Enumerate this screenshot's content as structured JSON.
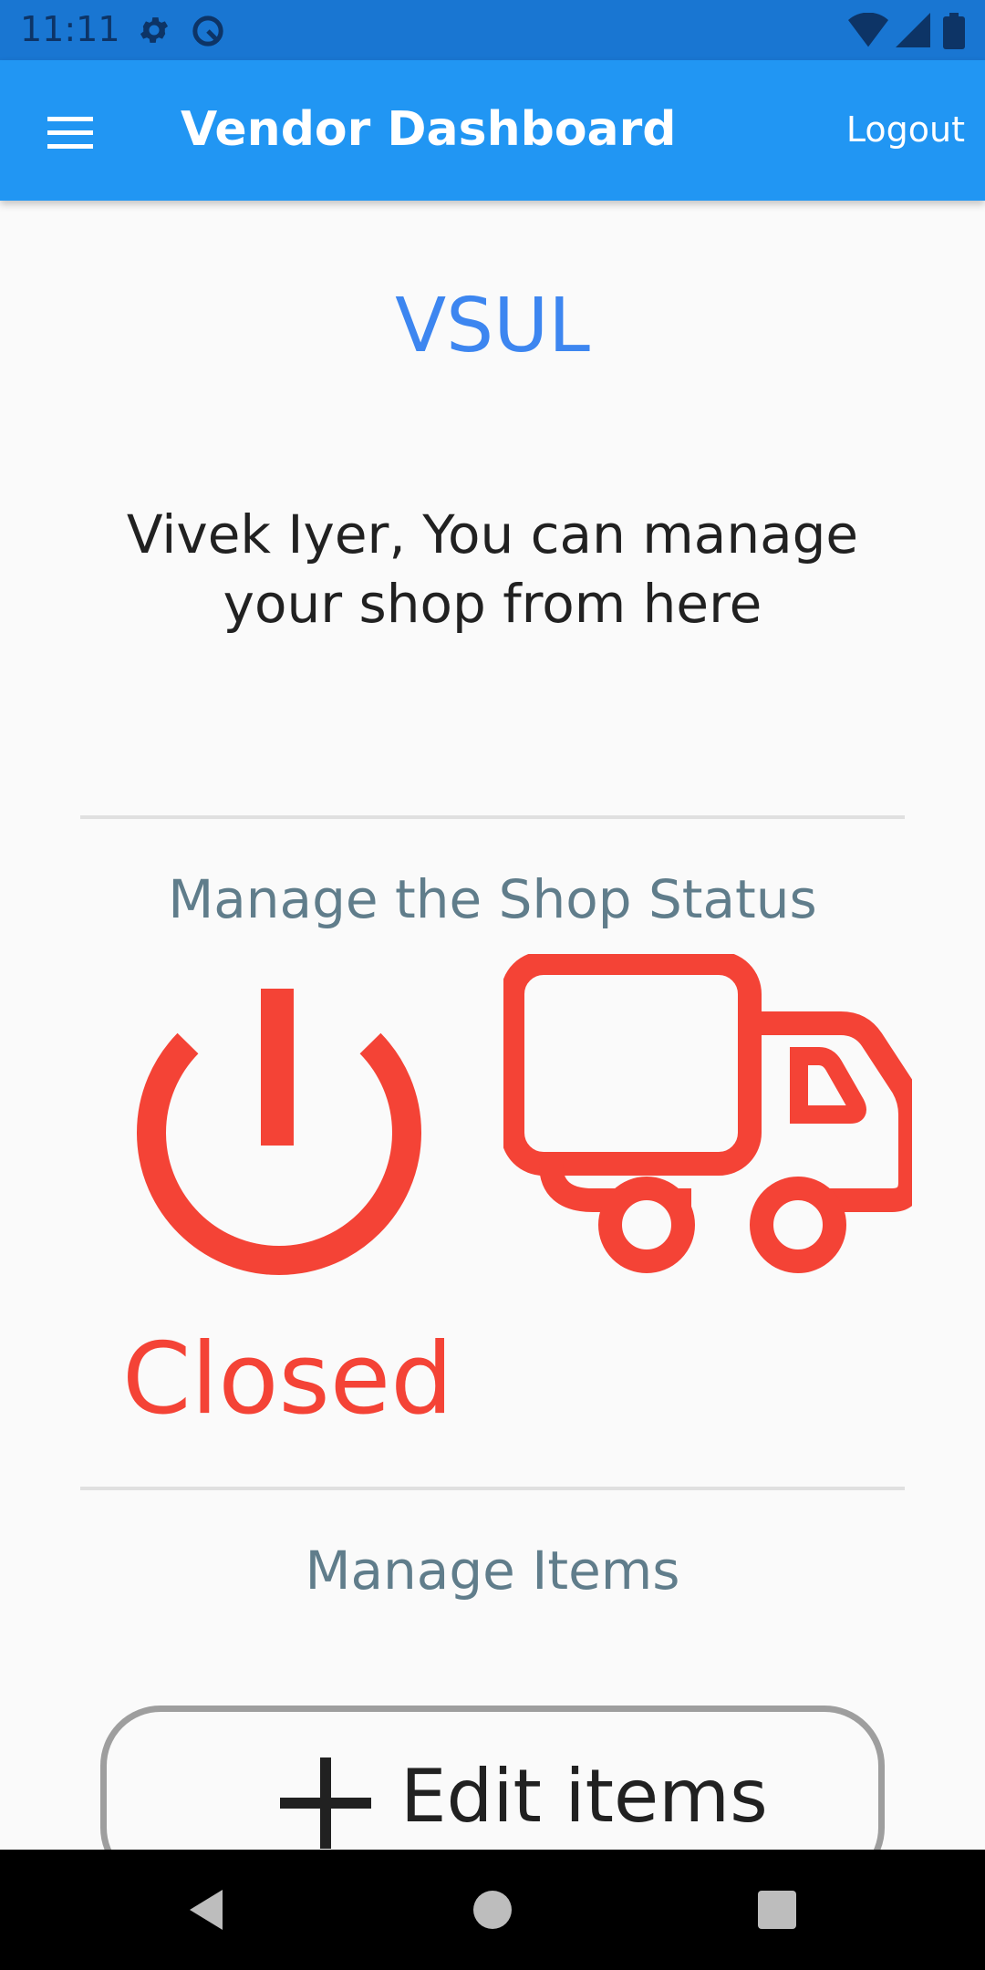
{
  "status_bar": {
    "time": "11:11",
    "icons": [
      "gear-icon",
      "data-saver-icon",
      "wifi-icon",
      "cell-signal-icon",
      "battery-icon"
    ]
  },
  "app_bar": {
    "title": "Vendor Dashboard",
    "logout_label": "Logout",
    "menu_icon": "hamburger-menu-icon",
    "color": "#2196f3"
  },
  "main": {
    "shop_name": "VSUL",
    "greeting": "Vivek Iyer, You can manage your shop from here",
    "shop_status_section": {
      "title": "Manage the Shop Status",
      "status": "Closed",
      "power_icon": "power-icon",
      "delivery_icon": "truck-icon",
      "status_color": "#f44336"
    },
    "items_section": {
      "title": "Manage Items",
      "edit_button_label": "Edit items",
      "edit_button_icon": "plus-icon"
    }
  },
  "nav_bar": {
    "buttons": [
      "back-icon",
      "home-icon",
      "recents-icon"
    ]
  }
}
